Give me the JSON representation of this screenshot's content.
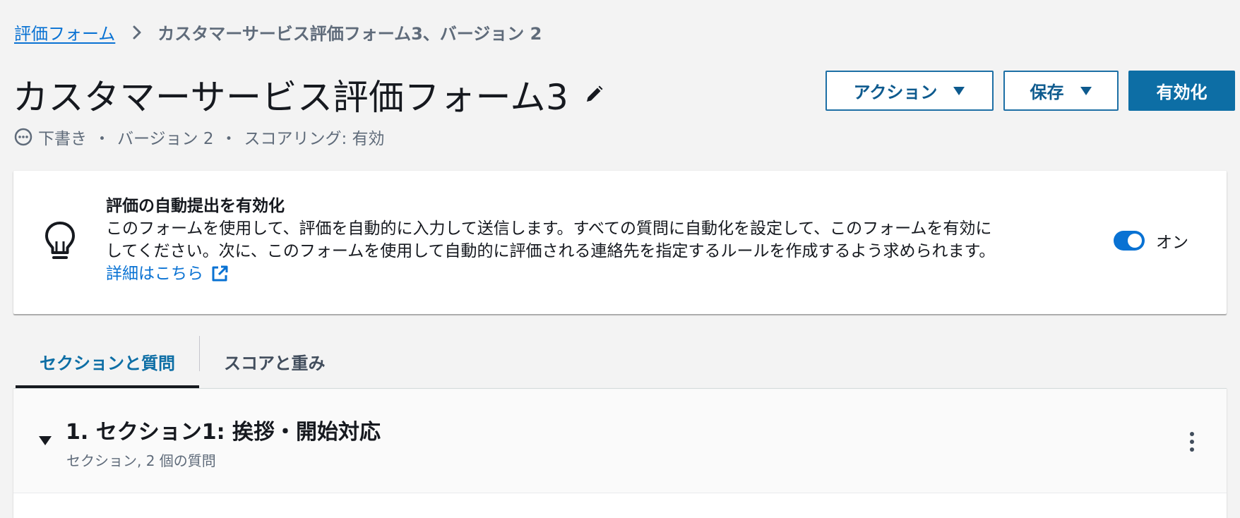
{
  "breadcrumb": {
    "parent": "評価フォーム",
    "current": "カスタマーサービス評価フォーム3、バージョン 2"
  },
  "header": {
    "title": "カスタマーサービス評価フォーム3",
    "status": "下書き",
    "version": "バージョン 2",
    "scoring": "スコアリング: 有効",
    "separator": "・"
  },
  "actions": {
    "actions_label": "アクション",
    "save_label": "保存",
    "activate_label": "有効化"
  },
  "auto_submit": {
    "title": "評価の自動提出を有効化",
    "line1": "このフォームを使用して、評価を自動的に入力して送信します。すべての質問に自動化を設定して、このフォームを有効に",
    "line2": "してください。次に、このフォームを使用して自動的に評価される連絡先を指定するルールを作成するよう求められます。",
    "link": "詳細はこちら",
    "toggle_label": "オン",
    "toggle_on": true
  },
  "tabs": [
    {
      "label": "セクションと質問",
      "active": true
    },
    {
      "label": "スコアと重み",
      "active": false
    }
  ],
  "section": {
    "title": "1. セクション1: 挨拶・開始対応",
    "subtitle": "セクション, 2 個の質問"
  },
  "colors": {
    "accent": "#0972d3",
    "primary_button": "#0d6ea5",
    "background": "#f3f3f3"
  },
  "icons": {
    "breadcrumb_separator": "chevron-right-icon",
    "edit": "pencil-icon",
    "status": "draft-status-icon",
    "dropdown": "caret-down-icon",
    "info": "lightbulb-icon",
    "external_link": "external-link-icon",
    "section_toggle": "caret-down-icon",
    "menu": "kebab-menu-icon"
  }
}
